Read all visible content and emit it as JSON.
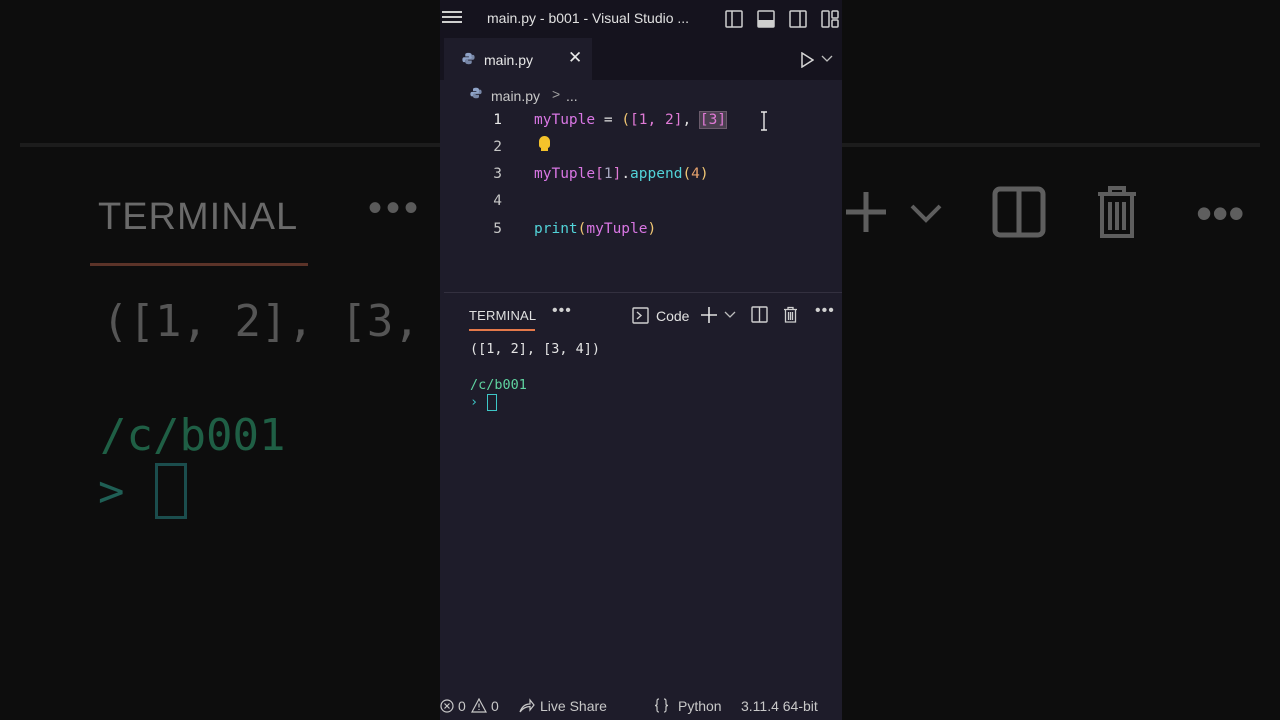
{
  "background": {
    "terminal_label": "TERMINAL",
    "dots": "•••",
    "output": "([1, 2], [3,",
    "path": "/c/b001",
    "prompt": ">"
  },
  "window": {
    "title": "main.py - b001 - Visual Studio ...",
    "accent_color": "#e5794a"
  },
  "tab": {
    "label": "main.py",
    "close": "✕"
  },
  "breadcrumb": {
    "file": "main.py",
    "separator": ">",
    "more": "..."
  },
  "editor": {
    "line_numbers": [
      "1",
      "2",
      "3",
      "4",
      "5"
    ],
    "line1": {
      "var": "myTuple",
      "eq": " = ",
      "open": "(",
      "a": "[1, 2]",
      "comma": ", ",
      "b": "[3]",
      "close": ""
    },
    "line3": {
      "var": "myTuple",
      "idx_open": "[",
      "idx": "1",
      "idx_close": "]",
      "dot": ".",
      "fn": "append",
      "p_open": "(",
      "arg": "4",
      "p_close": ")"
    },
    "line5": {
      "fn": "print",
      "p_open": "(",
      "arg": "myTuple",
      "p_close": ")"
    }
  },
  "panel": {
    "tab_label": "TERMINAL",
    "more": "•••",
    "terminal_name": "Code",
    "plus": "+",
    "chevron": "⌄",
    "actions_more": "•••"
  },
  "terminal": {
    "output": "([1, 2], [3, 4])",
    "path": "/c/b001",
    "prompt": "›"
  },
  "statusbar": {
    "errors": "0",
    "warnings": "0",
    "live_share": "Live Share",
    "language": "Python",
    "interpreter": "3.11.4 64-bit"
  }
}
